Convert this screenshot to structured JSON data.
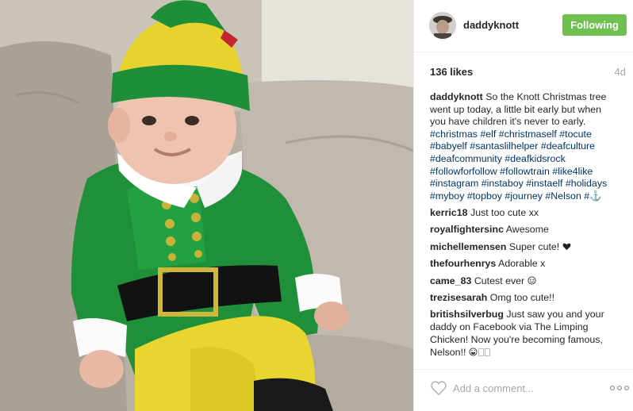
{
  "post": {
    "author": "daddyknott",
    "follow_label": "Following",
    "likes": "136 likes",
    "age": "4d",
    "caption": {
      "author": "daddyknott",
      "lines": [
        {
          "segments": [
            {
              "text": "So the Knott Christmas tree",
              "tag": false
            }
          ]
        },
        {
          "segments": [
            {
              "text": "went up today, a little bit early but when",
              "tag": false
            }
          ]
        },
        {
          "segments": [
            {
              "text": "you have children it's never to early.",
              "tag": false
            }
          ]
        },
        {
          "segments": [
            {
              "text": "#christmas",
              "tag": true
            },
            {
              "text": " ",
              "tag": false
            },
            {
              "text": "#elf",
              "tag": true
            },
            {
              "text": " ",
              "tag": false
            },
            {
              "text": "#christmaself",
              "tag": true
            },
            {
              "text": " ",
              "tag": false
            },
            {
              "text": "#tocute",
              "tag": true
            }
          ]
        },
        {
          "segments": [
            {
              "text": "#babyelf",
              "tag": true
            },
            {
              "text": " ",
              "tag": false
            },
            {
              "text": "#santaslilhelper",
              "tag": true
            },
            {
              "text": " ",
              "tag": false
            },
            {
              "text": "#deafculture",
              "tag": true
            }
          ]
        },
        {
          "segments": [
            {
              "text": "#deafcommunity",
              "tag": true
            },
            {
              "text": " ",
              "tag": false
            },
            {
              "text": "#deafkidsrock",
              "tag": true
            }
          ]
        },
        {
          "segments": [
            {
              "text": "#followforfollow",
              "tag": true
            },
            {
              "text": " ",
              "tag": false
            },
            {
              "text": "#followtrain",
              "tag": true
            },
            {
              "text": " ",
              "tag": false
            },
            {
              "text": "#like4like",
              "tag": true
            }
          ]
        },
        {
          "segments": [
            {
              "text": "#instagram",
              "tag": true
            },
            {
              "text": " ",
              "tag": false
            },
            {
              "text": "#instaboy",
              "tag": true
            },
            {
              "text": " ",
              "tag": false
            },
            {
              "text": "#instaelf",
              "tag": true
            },
            {
              "text": " ",
              "tag": false
            },
            {
              "text": "#holidays",
              "tag": true
            }
          ]
        },
        {
          "segments": [
            {
              "text": "#myboy",
              "tag": true
            },
            {
              "text": " ",
              "tag": false
            },
            {
              "text": "#topboy",
              "tag": true
            },
            {
              "text": " ",
              "tag": false
            },
            {
              "text": "#journey",
              "tag": true
            },
            {
              "text": " ",
              "tag": false
            },
            {
              "text": "#Nelson",
              "tag": true
            },
            {
              "text": " ",
              "tag": false
            },
            {
              "text": "#⚓",
              "tag": true
            }
          ]
        }
      ]
    },
    "comments": [
      {
        "user": "kerric18",
        "text": "Just too cute xx",
        "emoji": ""
      },
      {
        "user": "royalfightersinc",
        "text": "Awesome",
        "emoji": ""
      },
      {
        "user": "michellemensen",
        "text": "Super cute!",
        "emoji": "black-heart"
      },
      {
        "user": "thefourhenrys",
        "text": "Adorable x",
        "emoji": ""
      },
      {
        "user": "came_83",
        "text": "Cutest ever",
        "emoji": "smiling-face"
      },
      {
        "user": "trezisesarah",
        "text": "Omg too cute!!",
        "emoji": ""
      },
      {
        "user": "britishsilverbug",
        "text": "Just saw you and your daddy on Facebook via The Limping Chicken! Now you're becoming famous, Nelson!!",
        "emoji": "grinning-face-and-boxes"
      }
    ],
    "add_comment_placeholder": "Add a comment...",
    "icons": {
      "heart": "heart-icon",
      "more": "more-options-icon"
    },
    "colors": {
      "follow_button": "#70c050",
      "hashtag": "#003569",
      "muted": "#a5a7aa"
    }
  }
}
